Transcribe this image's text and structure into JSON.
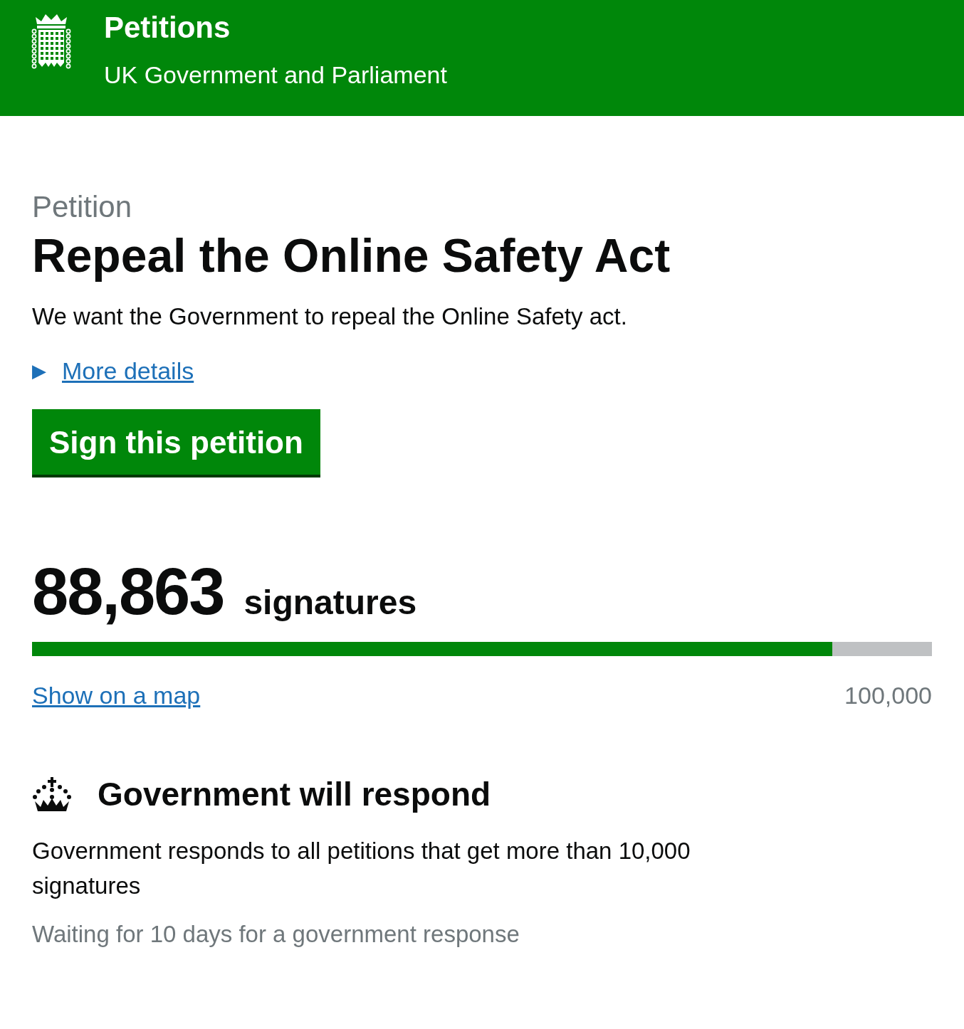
{
  "header": {
    "title": "Petitions",
    "subtitle": "UK Government and Parliament"
  },
  "petition": {
    "eyebrow": "Petition",
    "title": "Repeal the Online Safety Act",
    "summary": "We want the Government to repeal the Online Safety act.",
    "details_toggle": {
      "icon": "▶",
      "label": "More details",
      "expanded": false
    },
    "sign_button": "Sign this petition"
  },
  "signatures": {
    "count": "88,863",
    "label": "signatures",
    "progress": {
      "level": 0.889
    },
    "map_link": "Show on a map",
    "threshold": "100,000"
  },
  "response": {
    "title": "Government will respond",
    "body": "Government responds to all petitions that get more than 10,000 signatures",
    "status": "Waiting for 10 days for a government response"
  }
}
